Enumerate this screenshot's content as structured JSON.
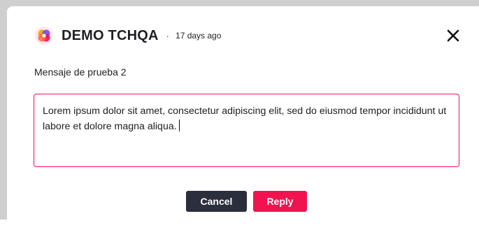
{
  "post": {
    "author": "DEMO TCHQA",
    "separator": "·",
    "time_ago": "17 days ago",
    "subject": "Mensaje de prueba 2"
  },
  "reply_box": {
    "value": "Lorem ipsum dolor sit amet, consectetur adipiscing elit, sed do eiusmod tempor incididunt ut labore et dolore magna aliqua."
  },
  "actions": {
    "cancel_label": "Cancel",
    "reply_label": "Reply"
  },
  "icons": {
    "logo": "app-logo-icon",
    "close": "close-icon"
  },
  "colors": {
    "accent": "#f0134f",
    "cancel_bg": "#2a2e3d",
    "border_accent": "#f0105a"
  }
}
